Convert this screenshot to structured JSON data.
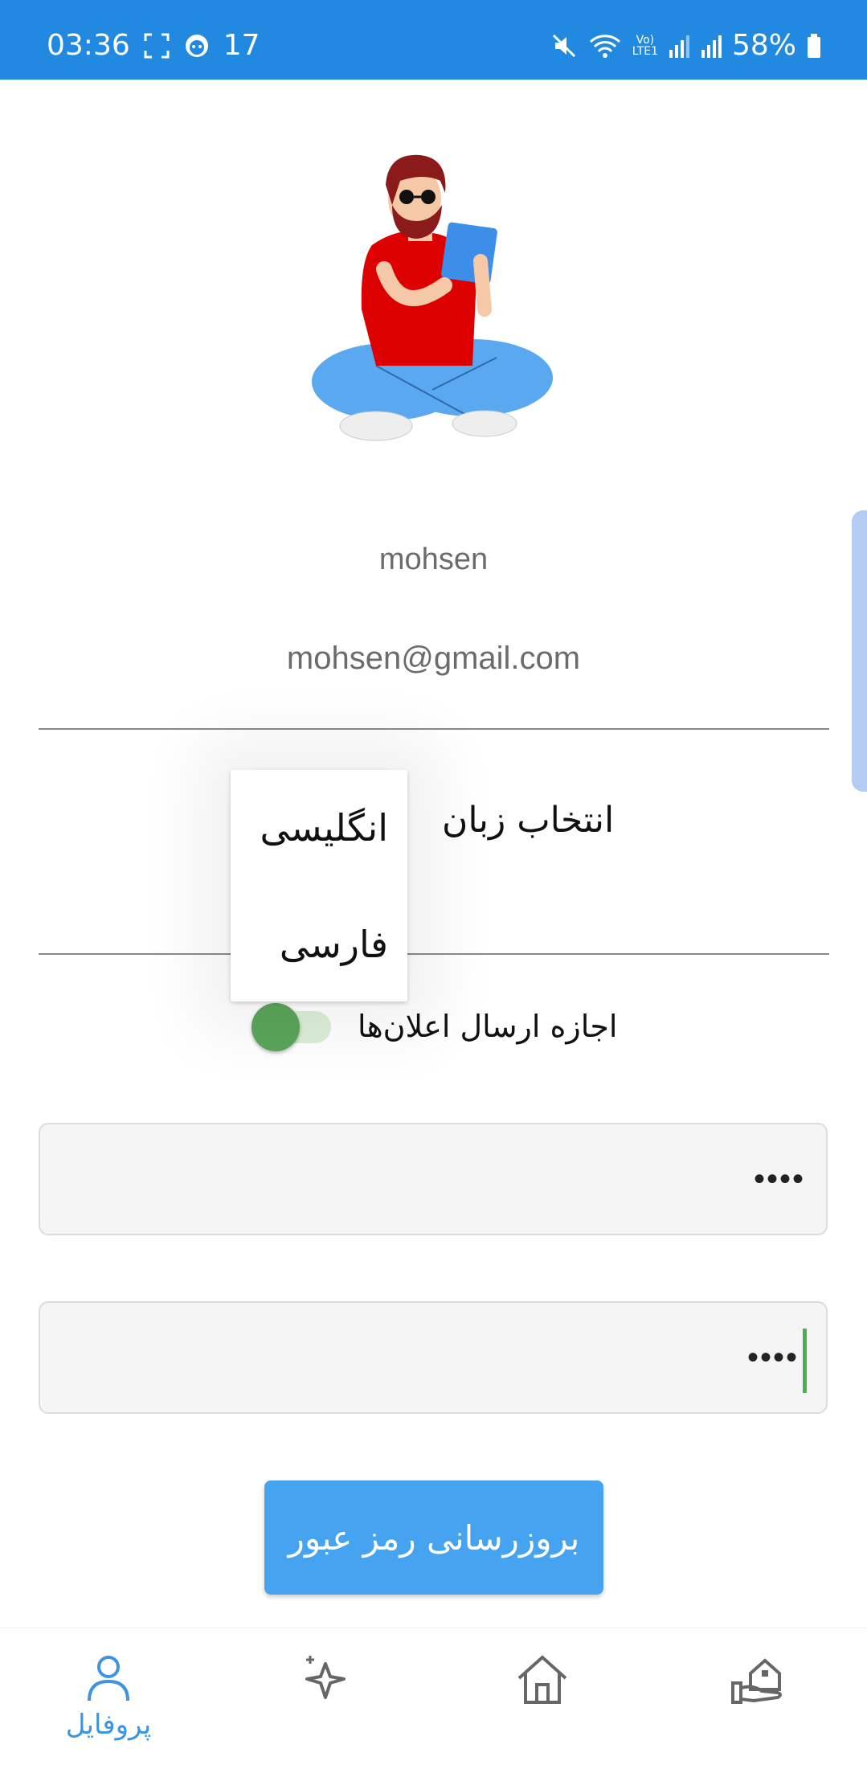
{
  "status_bar": {
    "time": "03:36",
    "notification_count": "17",
    "battery": "58%",
    "network_label": "LTE1"
  },
  "profile": {
    "username": "mohsen",
    "email": "mohsen@gmail.com"
  },
  "language": {
    "label": "انتخاب زبان",
    "options": [
      "انگلیسی",
      "فارسی"
    ]
  },
  "notifications": {
    "label": "اجازه ارسال اعلان‌ها",
    "enabled": true
  },
  "password_fields": [
    {
      "value": "••••"
    },
    {
      "value": "••••"
    }
  ],
  "update_password_button": "بروزرسانی رمز عبور",
  "bottom_nav": {
    "items": [
      {
        "icon": "user-icon",
        "label": "پروفایل",
        "active": true
      },
      {
        "icon": "sparkle-icon",
        "label": "",
        "active": false
      },
      {
        "icon": "home-icon",
        "label": "",
        "active": false
      },
      {
        "icon": "house-hand-icon",
        "label": "",
        "active": false
      }
    ]
  },
  "colors": {
    "status_bar": "#2189e0",
    "accent": "#46a3ef",
    "toggle_on": "#5aa55b",
    "nav_active": "#3d95e1",
    "text_muted": "#6b6b6b"
  }
}
